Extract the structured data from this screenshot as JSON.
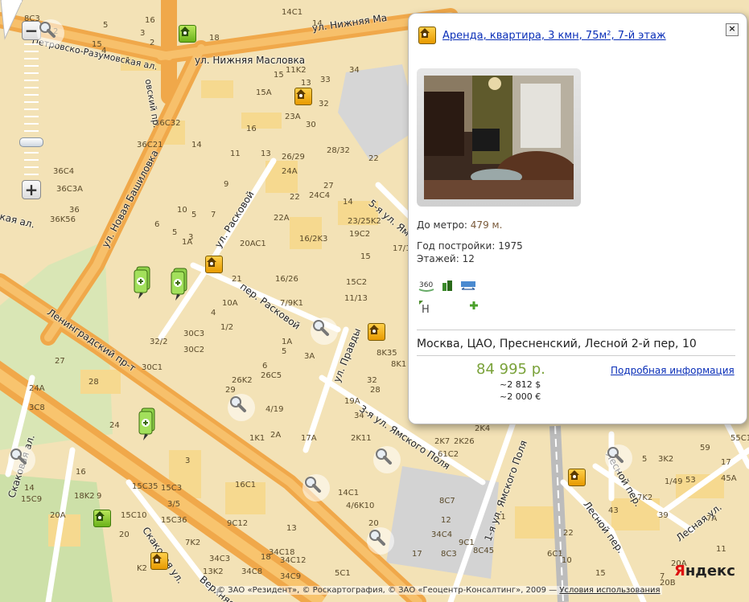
{
  "map": {
    "labels": [
      "8C3",
      "2",
      "5",
      "16",
      "14C1",
      "14",
      "15",
      "3",
      "2",
      "18",
      "4",
      "1",
      "15A",
      "15",
      "11K2",
      "13",
      "33",
      "34",
      "23A",
      "30",
      "32",
      "36C32",
      "16",
      "36C21",
      "14",
      "11",
      "13",
      "26/29",
      "28/32",
      "22",
      "36C4",
      "24A",
      "36C3A",
      "9",
      "22",
      "24C4",
      "27",
      "14",
      "36",
      "10",
      "5",
      "7",
      "22A",
      "23/25K2",
      "19C2",
      "36K56",
      "6",
      "5",
      "3",
      "1A",
      "20AC1",
      "16/2K3",
      "15",
      "17/1",
      "4",
      "21",
      "16/26",
      "15C2",
      "10A",
      "7/9K1",
      "11/13",
      "1/2",
      "32/2",
      "30C3",
      "30C2",
      "1A",
      "5",
      "3A",
      "8K35",
      "8K1",
      "30C1",
      "26K2",
      "26C5",
      "6",
      "32",
      "28",
      "29",
      "27",
      "28",
      "24A",
      "4/19",
      "19A",
      "34",
      "3C8",
      "24",
      "1K1",
      "2A",
      "17A",
      "2K11",
      "2K4",
      "2K7",
      "2K26",
      "61C2",
      "55C1",
      "59",
      "17",
      "3",
      "5",
      "3K2",
      "1/49",
      "53",
      "45A",
      "7K2",
      "14",
      "16",
      "18K2",
      "9",
      "15C35",
      "15C3",
      "16C1",
      "14C1",
      "4/6K10",
      "43",
      "39",
      "7A",
      "15C9",
      "3/5",
      "8C7",
      "12",
      "11",
      "20A",
      "15C10",
      "15C36",
      "9C12",
      "20",
      "13",
      "22",
      "20",
      "34C4",
      "9C1",
      "8C45",
      "6C1",
      "10",
      "7K2",
      "18",
      "17",
      "34C3",
      "34C18",
      "34C12",
      "8C3",
      "K2",
      "13K2",
      "34C8",
      "34C9",
      "5C1",
      "20B",
      "20A",
      "11",
      "15",
      "7"
    ],
    "streets": [
      "ул. Нижняя Масловка",
      "ул. Нижняя Ма",
      "Петровско-Разумовская ал.",
      "ул. Новая Башиловка",
      "ул. Расковой",
      "пер. Расковой",
      "5-я ул. Ямского Поля",
      "ул. Правды",
      "3-я ул. Ямского Поля",
      "1-я ул. Ямского Поля",
      "Ленинградский пр-т",
      "Скаковая ал.",
      "Скаковая ул.",
      "Лесной пер.",
      "Лесной пер.",
      "Лесная ул.",
      "Верхняя ул.",
      "кая ал.",
      "овский пр."
    ],
    "controls": {
      "zoom_in": "+",
      "zoom_out": "−",
      "zoom_level": 0.27
    }
  },
  "popup": {
    "title": "Аренда, квартира, 3 кмн, 75м², 7-й этаж",
    "metro_label": "До метро:",
    "metro_value": "479 м.",
    "year_label": "Год постройки:",
    "year_value": "1975",
    "floors_label": "Этажей:",
    "floors_value": "12",
    "feature_icons": [
      "360",
      "building-icon",
      "panorama-icon",
      "parking-icon",
      "plus-icon"
    ],
    "feature_text": {
      "tour": "360",
      "parking": "H"
    },
    "address": "Москва, ЦАО, Пресненский, Лесной 2-й пер, 10",
    "price_rub": "84 995 р.",
    "price_usd": "~2 812 $",
    "price_eur": "~2 000 €",
    "details_link": "Подробная информация",
    "close": "×"
  },
  "footer": {
    "copyright": "© ЗАО «Резидент», © Роскартография, © ЗАО «Геоцентр-Консалтинг», 2009 —",
    "terms": "Условия использования",
    "logo_first": "Я",
    "logo_rest": "ндекс"
  },
  "colors": {
    "block": "#f6dc9a",
    "road_major": "#f2a64a",
    "road_minor": "#ffffff",
    "park": "#cde4a3",
    "industrial": "#d4d4d4",
    "rail": "#bdbdbd",
    "price_green": "#7aa23a",
    "link_blue": "#0a2fb8"
  }
}
